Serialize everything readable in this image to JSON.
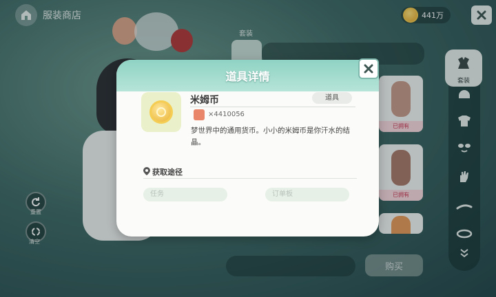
{
  "header": {
    "shop_title": "服装商店",
    "coin_amount": "441万"
  },
  "left_tools": [
    {
      "label": "重置"
    },
    {
      "label": "清空"
    }
  ],
  "panel": {
    "suit_tab_label": "套装",
    "cards": [
      {
        "status": "已拥有"
      },
      {
        "status": "已拥有"
      },
      {
        "status": ""
      }
    ],
    "buy_label": "购买"
  },
  "sidebar": {
    "active_label": "套装",
    "icons": [
      "suit-icon",
      "hair-icon",
      "top-icon",
      "face-icon",
      "hand-icon",
      "eyebrow-icon",
      "mouth-icon",
      "more-icon"
    ]
  },
  "dialog": {
    "title": "道具详情",
    "item_name": "米姆币",
    "item_tag": "道具",
    "item_count": "×4410056",
    "item_description": "梦世界中的通用货币。小小的米姆币是你汗水的结晶。",
    "source_title": "获取途径",
    "source_options": [
      "任务",
      "订单板"
    ]
  },
  "colors": {
    "header_teal": "#8fd3c4",
    "coin_gold": "#e9b133",
    "owned_red": "#cc3a55"
  }
}
